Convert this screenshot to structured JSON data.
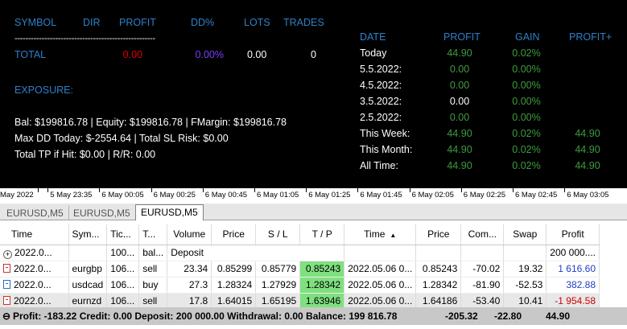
{
  "panel": {
    "headers": {
      "symbol": "SYMBOL",
      "dir": "DIR",
      "profit": "PROFIT",
      "dd": "DD%",
      "lots": "LOTS",
      "trades": "TRADES"
    },
    "separator": "----------------------------------------------------",
    "total": {
      "label": "TOTAL",
      "profit": "0.00",
      "dd": "0.00%",
      "lots": "0.00",
      "trades": "0"
    },
    "exposure_label": "EXPOSURE:",
    "account_lines": [
      "Bal: $199816.78 | Equity: $199816.78 | FMargin: $199816.78",
      "Max DD Today: $-2554.64 | Total SL Risk: $0.00",
      "Total TP if Hit: $0.00 | R/R: 0.00"
    ]
  },
  "stats": {
    "headers": {
      "date": "DATE",
      "profit": "PROFIT",
      "gain": "GAIN",
      "profit_plus": "PROFIT+"
    },
    "rows": [
      {
        "date": "Today",
        "profit": "44.90",
        "gain": "0.02%",
        "plus": "",
        "profit_color": "green"
      },
      {
        "date": "5.5.2022:",
        "profit": "0.00",
        "gain": "0.00%",
        "plus": "",
        "profit_color": "green"
      },
      {
        "date": "4.5.2022:",
        "profit": "0.00",
        "gain": "0.00%",
        "plus": "",
        "profit_color": "green"
      },
      {
        "date": "3.5.2022:",
        "profit": "0.00",
        "gain": "0.00%",
        "plus": "",
        "profit_color": "white"
      },
      {
        "date": "2.5.2022:",
        "profit": "0.00",
        "gain": "0.00%",
        "plus": "",
        "profit_color": "green"
      },
      {
        "date": "This Week:",
        "profit": "44.90",
        "gain": "0.02%",
        "plus": "44.90",
        "profit_color": "green"
      },
      {
        "date": "This Month:",
        "profit": "44.90",
        "gain": "0.02%",
        "plus": "44.90",
        "profit_color": "green"
      },
      {
        "date": "All Time:",
        "profit": "44.90",
        "gain": "0.02%",
        "plus": "44.90",
        "profit_color": "green"
      }
    ]
  },
  "axis": {
    "labels": [
      "May 2022",
      "5 May 23:35",
      "6 May 00:05",
      "6 May 00:25",
      "6 May 00:45",
      "6 May 01:05",
      "6 May 01:25",
      "6 May 01:45",
      "6 May 02:05",
      "6 May 02:25",
      "6 May 02:45",
      "6 May 03:05"
    ]
  },
  "tabs": [
    "EURUSD,M5",
    "EURUSD,M5",
    "EURUSD,M5"
  ],
  "active_tab": 2,
  "table": {
    "columns": [
      "Time",
      "Sym...",
      "Tic...",
      "T...",
      "Volume",
      "Price",
      "S / L",
      "T / P",
      "Time",
      "Price",
      "Com...",
      "Swap",
      "Profit"
    ],
    "sorted_column_arrow": "▲",
    "deposit_row": {
      "time": "2022.0...",
      "ticket": "100...",
      "type": "bal...",
      "comment": "Deposit",
      "profit": "200 000...."
    },
    "rows": [
      {
        "time": "2022.0...",
        "symbol": "eurgbp",
        "ticket": "106...",
        "type": "sell",
        "volume": "23.34",
        "price": "0.85299",
        "sl": "0.85779",
        "tp": "0.85243",
        "close_time": "2022.05.06 0...",
        "close_price": "0.85243",
        "commission": "-70.02",
        "swap": "19.32",
        "profit": "1 616.60",
        "sign": "pos",
        "icon": "sell"
      },
      {
        "time": "2022.0...",
        "symbol": "usdcad",
        "ticket": "106...",
        "type": "buy",
        "volume": "27.3",
        "price": "1.28324",
        "sl": "1.27929",
        "tp": "1.28342",
        "close_time": "2022.05.06 0...",
        "close_price": "1.28342",
        "commission": "-81.90",
        "swap": "-52.53",
        "profit": "382.88",
        "sign": "pos",
        "icon": "buy"
      },
      {
        "time": "2022.0...",
        "symbol": "eurnzd",
        "ticket": "106...",
        "type": "sell",
        "volume": "17.8",
        "price": "1.64015",
        "sl": "1.65195",
        "tp": "1.63946",
        "close_time": "2022.05.06 0...",
        "close_price": "1.64186",
        "commission": "-53.40",
        "swap": "10.41",
        "profit": "-1 954.58",
        "sign": "neg",
        "icon": "sell"
      }
    ],
    "summary": {
      "label": "Profit: -183.22  Credit: 0.00  Deposit: 200 000.00  Withdrawal: 0.00  Balance: 199 816.78",
      "commission": "-205.32",
      "swap": "-22.80",
      "profit": "44.90"
    }
  },
  "colors": {
    "blue": "#2f80c8",
    "green": "#3f9b3f",
    "red": "#e00000",
    "purple": "#7a3cff",
    "tp_highlight": "#7fe07f"
  }
}
